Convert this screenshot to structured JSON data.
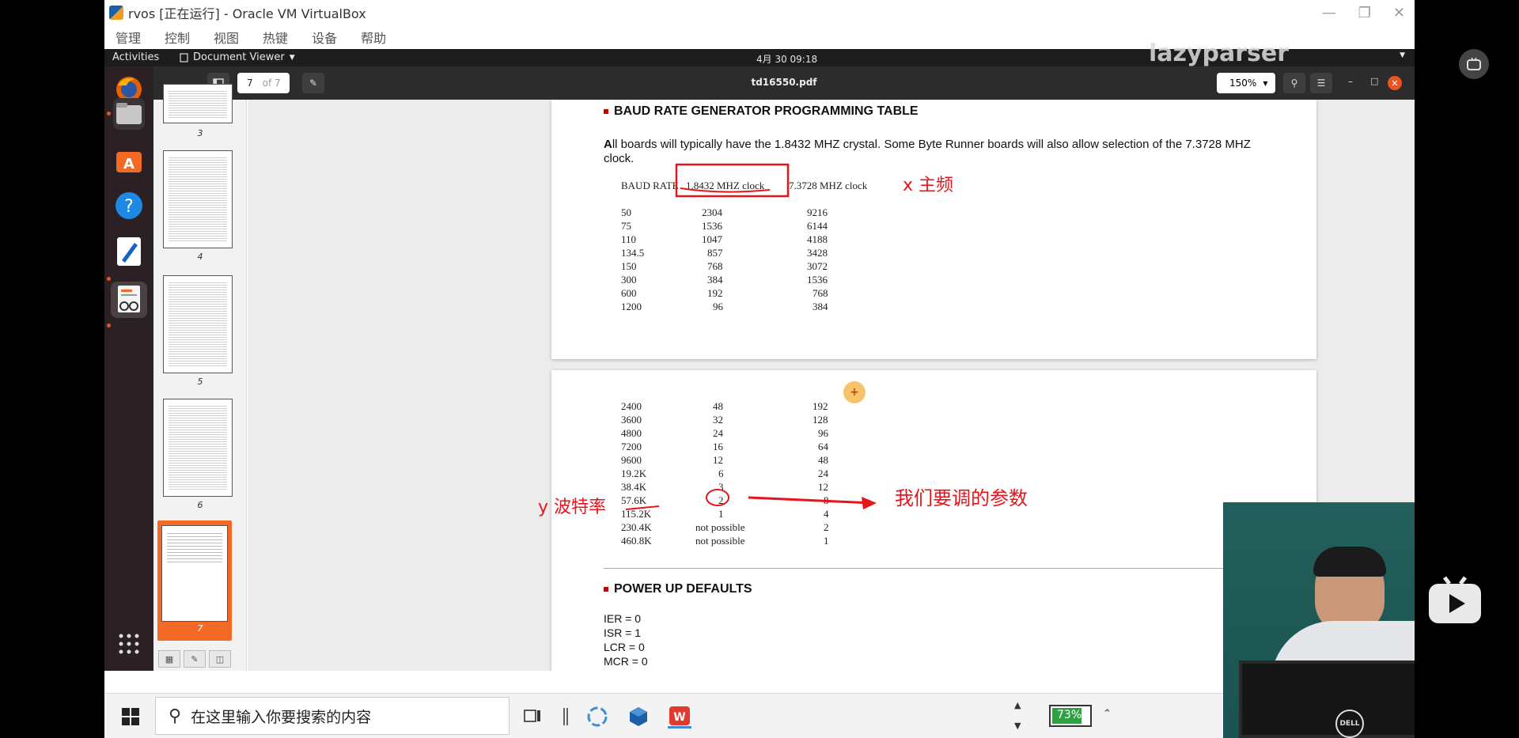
{
  "vbox": {
    "title": "rvos [正在运行] - Oracle VM VirtualBox",
    "menu": [
      "管理",
      "控制",
      "视图",
      "热键",
      "设备",
      "帮助"
    ]
  },
  "ubuntu_bar": {
    "activities": "Activities",
    "app_menu": "Document Viewer",
    "clock": "4月 30  09:18",
    "watermark": "lazyparser"
  },
  "viewer": {
    "page_current": "7",
    "page_total": "of 7",
    "doc_title": "td16550.pdf",
    "zoom": "150%"
  },
  "thumbnails": [
    "3",
    "4",
    "5",
    "6",
    "7"
  ],
  "document": {
    "section1_title": "BAUD RATE GENERATOR PROGRAMMING TABLE",
    "section1_para_bold": "A",
    "section1_para_rest": "ll boards will typically have the 1.8432 MHZ crystal. Some Byte Runner boards will also allow selection of the 7.3728 MHZ clock.",
    "table_headers": [
      "BAUD RATE",
      "1.8432 MHZ clock",
      "7.3728 MHZ clock"
    ],
    "rows_page1": [
      [
        "50",
        "2304",
        "9216"
      ],
      [
        "75",
        "1536",
        "6144"
      ],
      [
        "110",
        "1047",
        "4188"
      ],
      [
        "134.5",
        "857",
        "3428"
      ],
      [
        "150",
        "768",
        "3072"
      ],
      [
        "300",
        "384",
        "1536"
      ],
      [
        "600",
        "192",
        "768"
      ],
      [
        "1200",
        "96",
        "384"
      ]
    ],
    "rows_page2": [
      [
        "2400",
        "48",
        "192"
      ],
      [
        "3600",
        "32",
        "128"
      ],
      [
        "4800",
        "24",
        "96"
      ],
      [
        "7200",
        "16",
        "64"
      ],
      [
        "9600",
        "12",
        "48"
      ],
      [
        "19.2K",
        "6",
        "24"
      ],
      [
        "38.4K",
        "3",
        "12"
      ],
      [
        "57.6K",
        "2",
        "8"
      ],
      [
        "115.2K",
        "1",
        "4"
      ],
      [
        "230.4K",
        "not possible",
        "2"
      ],
      [
        "460.8K",
        "not possible",
        "1"
      ]
    ],
    "section2_title": "POWER UP DEFAULTS",
    "defaults": [
      "IER = 0",
      "ISR = 1",
      "LCR = 0",
      "MCR = 0"
    ]
  },
  "annotations": {
    "x_label": "x 主频",
    "y_label": "y 波特率",
    "arrow_label": "我们要调的参数",
    "color": "#e8141c"
  },
  "taskbar": {
    "search_placeholder": "在这里输入你要搜索的内容",
    "battery": "73%"
  }
}
